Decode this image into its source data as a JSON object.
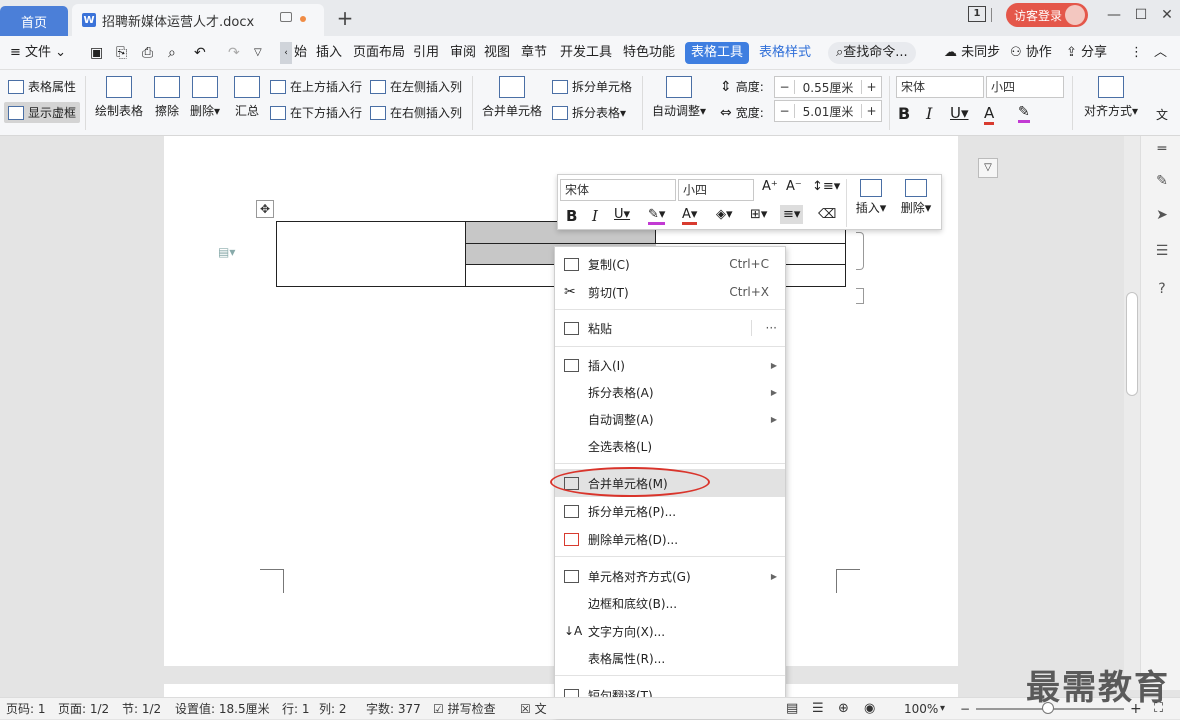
{
  "tabs": {
    "home": "首页",
    "doc": "招聘新媒体运营人才.docx",
    "page_indicator": "1",
    "login": "访客登录"
  },
  "menu": {
    "file": "文件",
    "items": [
      "始",
      "插入",
      "页面布局",
      "引用",
      "审阅",
      "视图",
      "章节",
      "开发工具",
      "特色功能"
    ],
    "table_tools": "表格工具",
    "table_style": "表格样式",
    "search": "查找命令...",
    "sync": "未同步",
    "collab": "协作",
    "share": "分享"
  },
  "ribbon": {
    "table_props": "表格属性",
    "show_grid": "显示虚框",
    "draw_table": "绘制表格",
    "eraser": "擦除",
    "delete": "删除",
    "summary": "汇总",
    "insert_above": "在上方插入行",
    "insert_below": "在下方插入行",
    "insert_left": "在左侧插入列",
    "insert_right": "在右侧插入列",
    "merge_cells": "合并单元格",
    "split_cells": "拆分单元格",
    "split_table": "拆分表格",
    "autofit": "自动调整",
    "height_label": "高度:",
    "height_value": "0.55厘米",
    "width_label": "宽度:",
    "width_value": "5.01厘米",
    "font": "宋体",
    "size": "小四",
    "align": "对齐方式",
    "text_dir": "文"
  },
  "minibar": {
    "font": "宋体",
    "size": "小四",
    "insert": "插入",
    "delete": "删除"
  },
  "context_menu": {
    "copy": "复制(C)",
    "copy_sc": "Ctrl+C",
    "cut": "剪切(T)",
    "cut_sc": "Ctrl+X",
    "paste": "粘贴",
    "paste_more": "···",
    "insert": "插入(I)",
    "split_table": "拆分表格(A)",
    "autofit": "自动调整(A)",
    "select_table": "全选表格(L)",
    "merge": "合并单元格(M)",
    "split_cells": "拆分单元格(P)...",
    "delete_cells": "删除单元格(D)...",
    "cell_align": "单元格对齐方式(G)",
    "borders": "边框和底纹(B)...",
    "text_dir": "文字方向(X)...",
    "table_props": "表格属性(R)...",
    "translate": "短句翻译(T)"
  },
  "status": {
    "page_num": "页码: 1",
    "pages": "页面: 1/2",
    "section": "节: 1/2",
    "setting": "设置值: 18.5厘米",
    "row": "行: 1",
    "col": "列: 2",
    "words": "字数: 377",
    "spell": "拼写检查",
    "doc_partial": "文",
    "zoom": "100%"
  },
  "watermark": "最需教育",
  "colors": {
    "accent": "#3e7ee0",
    "login": "#e4574a",
    "highlight_ring": "#d9342b"
  }
}
